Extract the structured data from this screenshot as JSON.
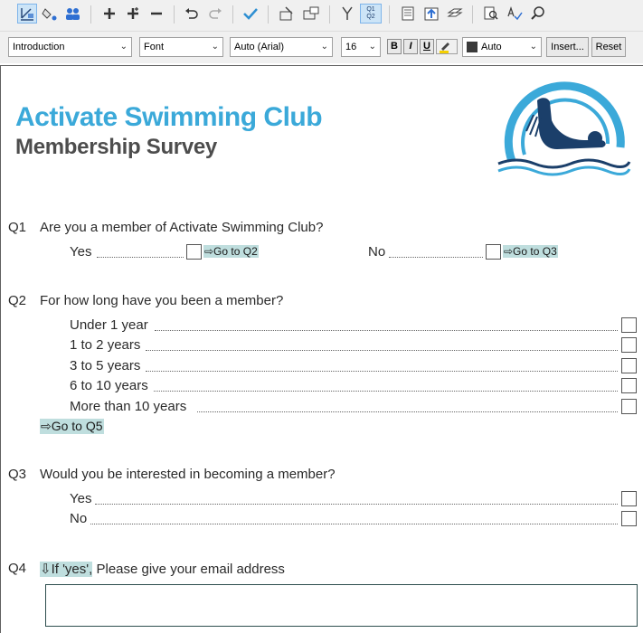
{
  "toolbar": {
    "icons": [
      "design-mode-icon",
      "fill-icon",
      "users-icon",
      "add-icon",
      "add-multiple-icon",
      "remove-icon",
      "undo-icon",
      "redo-icon",
      "check-icon",
      "properties-icon",
      "rename-icon",
      "branch-icon",
      "q1q2-icon",
      "page-icon",
      "upload-icon",
      "layers-icon",
      "find-page-icon",
      "spell-check-icon",
      "search-icon"
    ],
    "q1q2_label_top": "Q1",
    "q1q2_label_bottom": "Q2"
  },
  "format_bar": {
    "style_value": "Introduction",
    "font_value": "Font",
    "face_value": "Auto (Arial)",
    "size_value": "16",
    "bold": "B",
    "italic": "I",
    "underline": "U",
    "color_value": "Auto",
    "insert_label": "Insert...",
    "reset_label": "Reset",
    "color_swatch": "#3a3a3a"
  },
  "document": {
    "title": "Activate Swimming Club",
    "subtitle": "Membership Survey",
    "title_color": "#3ba9d9",
    "q1": {
      "num": "Q1",
      "text": "Are you a member of Activate Swimming Club?",
      "yes": "Yes",
      "yes_goto": "⇨Go to Q2",
      "no": "No",
      "no_goto": "⇨Go to Q3"
    },
    "q2": {
      "num": "Q2",
      "text": "For how long have you been a member?",
      "options": [
        "Under 1 year",
        "1 to 2 years",
        "3 to 5 years",
        "6 to 10 years",
        "More than 10 years"
      ],
      "goto": "⇨Go to Q5"
    },
    "q3": {
      "num": "Q3",
      "text": "Would you be interested in becoming a member?",
      "options": [
        "Yes",
        "No"
      ]
    },
    "q4": {
      "num": "Q4",
      "condition": "⇩If 'yes',",
      "text": " Please give your email address",
      "email_value": ""
    }
  }
}
